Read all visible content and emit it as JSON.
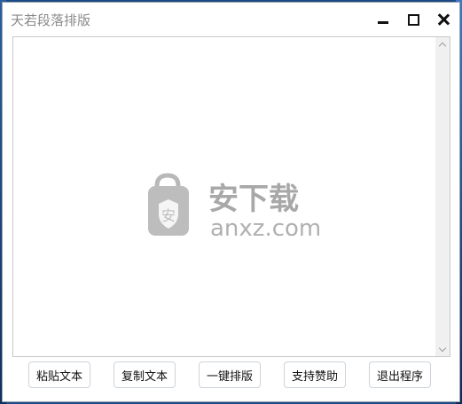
{
  "window": {
    "title": "天若段落排版",
    "controls": {
      "minimize": "minimize-icon",
      "maximize": "maximize-icon",
      "close": "close-icon"
    }
  },
  "editor": {
    "value": "",
    "scrollbar": {
      "up_icon": "chevron-up-icon",
      "down_icon": "chevron-down-icon"
    }
  },
  "watermark": {
    "brand": "安下载",
    "domain": "anxz.com",
    "badge_char": "安"
  },
  "buttons": [
    {
      "label": "粘贴文本"
    },
    {
      "label": "复制文本"
    },
    {
      "label": "一键排版"
    },
    {
      "label": "支持赞助"
    },
    {
      "label": "退出程序"
    }
  ],
  "colors": {
    "title_text": "#8a8a8a",
    "button_border": "#cdd3da",
    "watermark_gray": "#9a9a9a",
    "desktop_blue": "#1b4a86"
  }
}
